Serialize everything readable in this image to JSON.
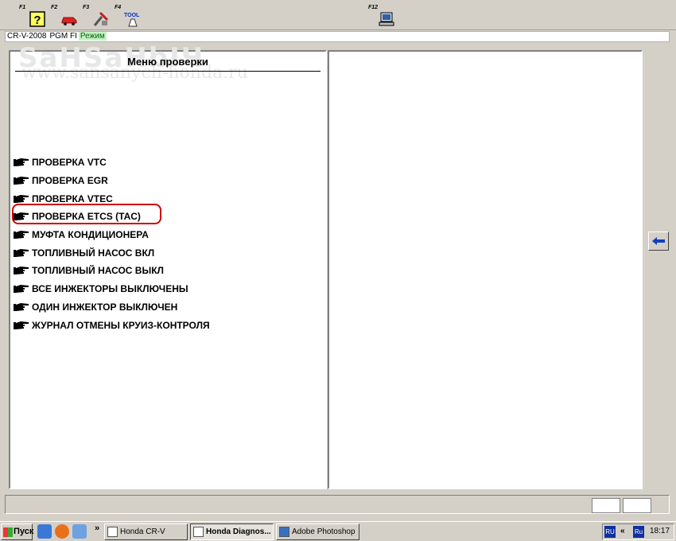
{
  "toolbar": {
    "f1": "F1",
    "f2": "F2",
    "f3": "F3",
    "f4": "F4",
    "f12": "F12",
    "f1_icon": "help-icon",
    "f2_icon": "car-icon",
    "f3_icon": "tools-icon",
    "f4_icon": "tool-icon",
    "f12_icon": "computer-icon",
    "tool_text": "TOOL"
  },
  "status": {
    "model": "CR-V-2008",
    "system": "PGM FI",
    "mode": "Режим"
  },
  "watermark": {
    "line1": "SaHSaHbIЧ",
    "line2": "www.sansanych-honda.ru"
  },
  "menu": {
    "title": "Меню проверки",
    "items": [
      "ПРОВЕРКА VTC",
      "ПРОВЕРКА EGR",
      "ПРОВЕРКА VTEC",
      "ПРОВЕРКА ETCS (TAC)",
      "МУФТА КОНДИЦИОНЕРА",
      "ТОПЛИВНЫЙ НАСОС ВКЛ",
      "ТОПЛИВНЫЙ НАСОС ВЫКЛ",
      "ВСЕ ИНЖЕКТОРЫ ВЫКЛЮЧЕНЫ",
      "ОДИН ИНЖЕКТОР ВЫКЛЮЧЕН",
      "ЖУРНАЛ ОТМЕНЫ КРУИЗ-КОНТРОЛЯ"
    ],
    "highlighted_item": "ПРОВЕРКА ETCS (TAC)",
    "highlight_color": "#d00000"
  },
  "taskbar": {
    "start": "Пуск",
    "chevron": "»",
    "tasks": [
      "Honda CR-V",
      "Honda Diagnos...",
      "Adobe Photoshop"
    ],
    "lang1": "RU",
    "lang2": "Ru",
    "arrows": "«",
    "clock": "18:17"
  }
}
